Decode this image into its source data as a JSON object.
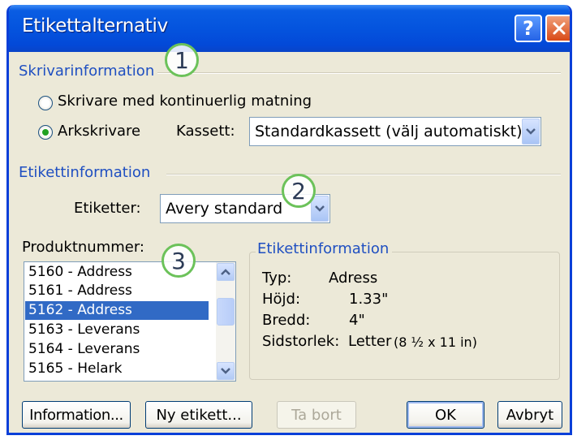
{
  "window": {
    "title": "Etikettalternativ",
    "help_label": "?"
  },
  "printer_info": {
    "heading": "Skrivarinformation",
    "continuous_label": "Skrivare med kontinuerlig matning",
    "continuous_checked": false,
    "page_printer_label": "Arkskrivare",
    "page_printer_checked": true,
    "tray_label": "Kassett:",
    "tray_value": "Standardkassett (välj automatiskt)"
  },
  "label_info": {
    "heading": "Etikettinformation",
    "vendor_label": "Etiketter:",
    "vendor_value": "Avery standard"
  },
  "product": {
    "label": "Produktnummer:",
    "items": [
      {
        "text": "5160 - Address",
        "selected": false
      },
      {
        "text": "5161 - Address",
        "selected": false
      },
      {
        "text": "5162 - Address",
        "selected": true
      },
      {
        "text": "5163 - Leverans",
        "selected": false
      },
      {
        "text": "5164 - Leverans",
        "selected": false
      },
      {
        "text": "5165 - Helark",
        "selected": false
      }
    ]
  },
  "details": {
    "heading": "Etikettinformation",
    "type_label": "Typ:",
    "type_value": "Adress",
    "height_label": "Höjd:",
    "height_value": "1.33\"",
    "width_label": "Bredd:",
    "width_value": "4\"",
    "pagesize_label": "Sidstorlek:",
    "pagesize_value": "Letter",
    "pagesize_dims": "(8 ½ x 11 in)"
  },
  "buttons": {
    "details": "Information...",
    "new_label": "Ny etikett...",
    "delete": "Ta bort",
    "ok": "OK",
    "cancel": "Avbryt"
  },
  "callouts": {
    "one": "1",
    "two": "2",
    "three": "3"
  },
  "colors": {
    "titlebar": "#0454de",
    "section_heading": "#1f4fc1",
    "selection": "#316ac5",
    "callout_ring": "#6cc25a"
  }
}
